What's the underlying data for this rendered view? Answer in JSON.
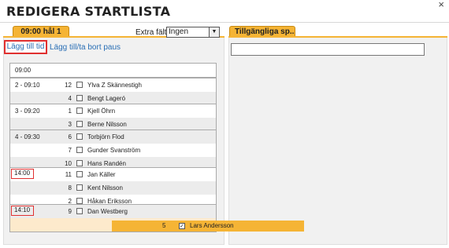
{
  "dialog": {
    "title": "REDIGERA STARTLISTA",
    "close_icon": "×"
  },
  "left_tab": {
    "label": "09:00 hål 1"
  },
  "right_tab": {
    "label": "Tillgängliga sp..."
  },
  "extra_field": {
    "label": "Extra fält:",
    "selected": "Ingen"
  },
  "links": {
    "add_time": "Lägg till tid",
    "add_remove_pause": "Lägg till/ta bort paus"
  },
  "lanes": [
    {
      "rows": [
        {
          "label": "09:00",
          "num": "",
          "name": "",
          "checkbox": false
        }
      ]
    },
    {
      "rows": [
        {
          "label": "2 - 09:10",
          "num": "12",
          "name": "Ylva Z Skännestigh",
          "checkbox": true
        },
        {
          "label": "",
          "num": "4",
          "name": "Bengt Lageró",
          "checkbox": true
        }
      ]
    },
    {
      "rows": [
        {
          "label": "3 - 09:20",
          "num": "1",
          "name": "Kjell Öhrn",
          "checkbox": true
        },
        {
          "label": "",
          "num": "3",
          "name": "Berne Nilsson",
          "checkbox": true
        }
      ]
    },
    {
      "rows": [
        {
          "label": "4 - 09:30",
          "num": "6",
          "name": "Torbjörn Flod",
          "checkbox": true
        },
        {
          "label": "",
          "num": "7",
          "name": "Gunder Svanström",
          "checkbox": true
        },
        {
          "label": "",
          "num": "10",
          "name": "Hans Randén",
          "checkbox": true
        }
      ]
    },
    {
      "rows": [
        {
          "label": "14:00",
          "num": "11",
          "name": "Jan Käller",
          "checkbox": true
        },
        {
          "label": "",
          "num": "8",
          "name": "Kent Nilsson",
          "checkbox": true
        },
        {
          "label": "",
          "num": "2",
          "name": "Håkan Eriksson",
          "checkbox": true
        }
      ]
    },
    {
      "rows": [
        {
          "label": "14:10",
          "num": "9",
          "name": "Dan Westberg",
          "checkbox": true
        }
      ]
    }
  ],
  "dragging": {
    "num": "5",
    "name": "Lars Andersson",
    "checked": true,
    "check_glyph": "✓"
  },
  "colors": {
    "accent": "#f5b435",
    "link": "#2a6fb5",
    "highlight": "#e03030"
  }
}
